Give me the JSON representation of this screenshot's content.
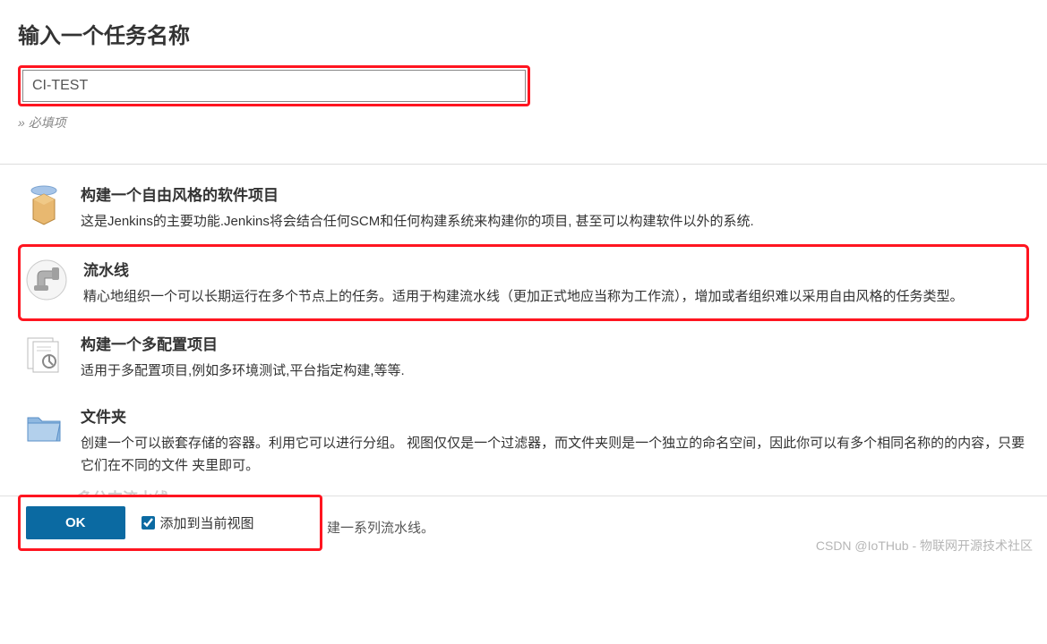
{
  "header": {
    "title": "输入一个任务名称",
    "input_value": "CI-TEST",
    "required_hint": "» 必填项"
  },
  "options": [
    {
      "id": "freestyle",
      "title": "构建一个自由风格的软件项目",
      "desc": "这是Jenkins的主要功能.Jenkins将会结合任何SCM和任何构建系统来构建你的项目, 甚至可以构建软件以外的系统."
    },
    {
      "id": "pipeline",
      "title": "流水线",
      "desc": "精心地组织一个可以长期运行在多个节点上的任务。适用于构建流水线（更加正式地应当称为工作流），增加或者组织难以采用自由风格的任务类型。",
      "highlighted": true
    },
    {
      "id": "multi-config",
      "title": "构建一个多配置项目",
      "desc": "适用于多配置项目,例如多环境测试,平台指定构建,等等."
    },
    {
      "id": "folder",
      "title": "文件夹",
      "desc": "创建一个可以嵌套存储的容器。利用它可以进行分组。 视图仅仅是一个过滤器，而文件夹则是一个独立的命名空间，因此你可以有多个相同名称的的内容，只要它们在不同的文件 夹里即可。"
    }
  ],
  "partial_option": {
    "title": "多分支流水线",
    "desc_trail": "建一系列流水线。"
  },
  "footer": {
    "ok_label": "OK",
    "checkbox_label": "添加到当前视图",
    "checkbox_checked": true
  },
  "watermark": "CSDN @IoTHub - 物联网开源技术社区"
}
